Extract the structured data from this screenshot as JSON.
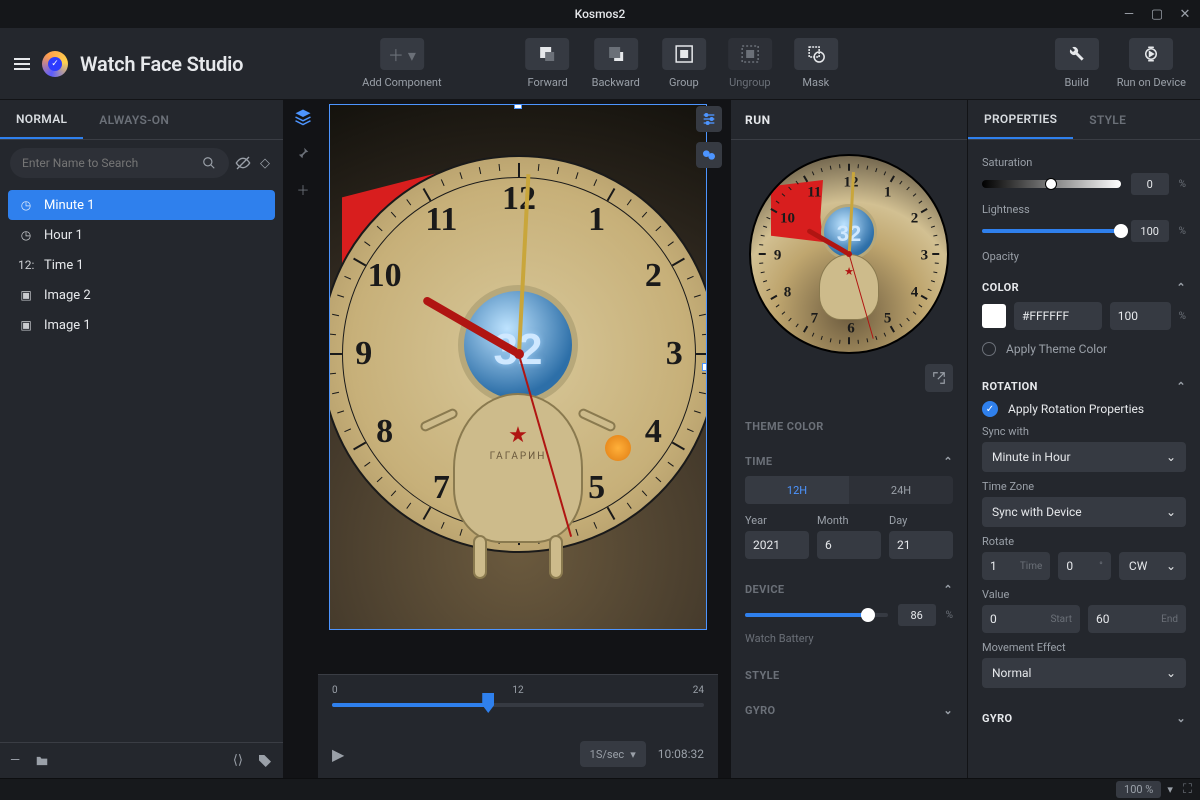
{
  "window": {
    "title": "Kosmos2"
  },
  "brand": "Watch Face Studio",
  "toolbar": {
    "add": "Add Component",
    "forward": "Forward",
    "backward": "Backward",
    "group": "Group",
    "ungroup": "Ungroup",
    "mask": "Mask",
    "build": "Build",
    "runOnDevice": "Run on Device"
  },
  "layerTabs": {
    "normal": "NORMAL",
    "always": "ALWAYS-ON"
  },
  "search": {
    "placeholder": "Enter Name to Search"
  },
  "layers": [
    {
      "icon": "clock",
      "label": "Minute 1",
      "selected": true
    },
    {
      "icon": "clock",
      "label": "Hour 1"
    },
    {
      "icon": "text",
      "label": "Time 1"
    },
    {
      "icon": "image",
      "label": "Image 2"
    },
    {
      "icon": "image",
      "label": "Image 1"
    }
  ],
  "timeline": {
    "start": "0",
    "mid": "12",
    "end": "24",
    "rate": "1S/sec",
    "readout": "10:08:32",
    "headPercent": 42
  },
  "run": {
    "title": "RUN",
    "themeColor": "THEME COLOR",
    "time": {
      "title": "TIME",
      "opt12": "12H",
      "opt24": "24H",
      "yearLabel": "Year",
      "year": "2021",
      "monthLabel": "Month",
      "month": "6",
      "dayLabel": "Day",
      "day": "21"
    },
    "device": {
      "title": "DEVICE",
      "value": "86",
      "unit": "%",
      "label": "Watch Battery",
      "percent": 86
    },
    "style": "STYLE",
    "gyro": "GYRO"
  },
  "props": {
    "tabProps": "PROPERTIES",
    "tabStyle": "STYLE",
    "saturation": {
      "label": "Saturation",
      "value": "0",
      "unit": "%",
      "knob": 50
    },
    "lightness": {
      "label": "Lightness",
      "value": "100",
      "unit": "%",
      "knob": 100
    },
    "opacityLabel": "Opacity",
    "color": {
      "title": "COLOR",
      "hex": "#FFFFFF",
      "opacity": "100",
      "unit": "%",
      "applyTheme": "Apply Theme Color"
    },
    "rotation": {
      "title": "ROTATION",
      "apply": "Apply Rotation Properties",
      "syncLabel": "Sync with",
      "sync": "Minute in Hour",
      "tzLabel": "Time Zone",
      "tz": "Sync with Device",
      "rotateLabel": "Rotate",
      "rotate": "1",
      "timeSuffix": "Time",
      "angle": "0",
      "angleUnit": "°",
      "dir": "CW",
      "valueLabel": "Value",
      "start": "0",
      "startSuffix": "Start",
      "end": "60",
      "endSuffix": "End",
      "moveLabel": "Movement Effect",
      "move": "Normal"
    },
    "gyro": "GYRO"
  },
  "status": {
    "zoom": "100",
    "zoomUnit": "%"
  },
  "clock": {
    "numbers": [
      "12",
      "1",
      "2",
      "3",
      "4",
      "5",
      "6",
      "7",
      "8",
      "9",
      "10",
      "11"
    ],
    "digit": "32",
    "body": "ГАГАРИН"
  }
}
